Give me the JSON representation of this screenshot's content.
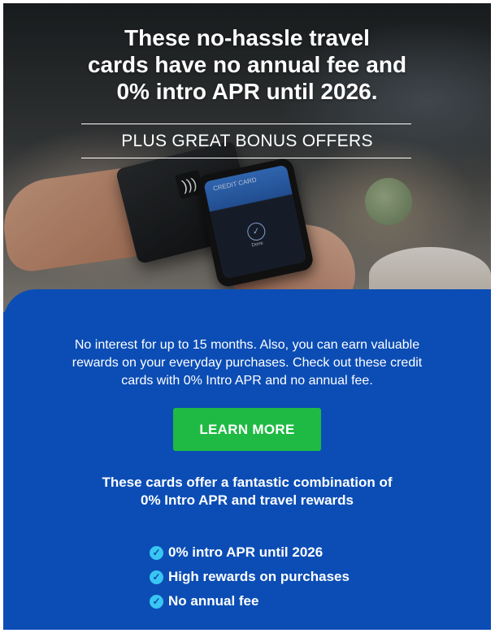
{
  "hero": {
    "headline_line1": "These no-hassle travel",
    "headline_line2": "cards have no annual fee and",
    "headline_line3": "0% intro APR until 2026.",
    "subheading": "PLUS GREAT BONUS OFFERS",
    "phone_label": "CREDIT CARD",
    "phone_done": "Done"
  },
  "content": {
    "body_line1": "No interest for up to 15 months. Also, you can earn valuable",
    "body_line2": "rewards on your everyday purchases. Check out these credit",
    "body_line3": "cards with 0% Intro APR and no annual fee.",
    "cta_label": "LEARN MORE",
    "offer_line1": "These cards offer a fantastic combination of",
    "offer_line2": "0% Intro APR and travel rewards",
    "benefits": [
      "0% intro APR until 2026",
      "High rewards on purchases",
      "No annual fee"
    ]
  },
  "colors": {
    "panel_blue": "#0b4db5",
    "cta_green": "#1fba43",
    "check_cyan": "#3ac6f2"
  },
  "icons": [
    "contactless-icon",
    "check-circle-icon"
  ]
}
